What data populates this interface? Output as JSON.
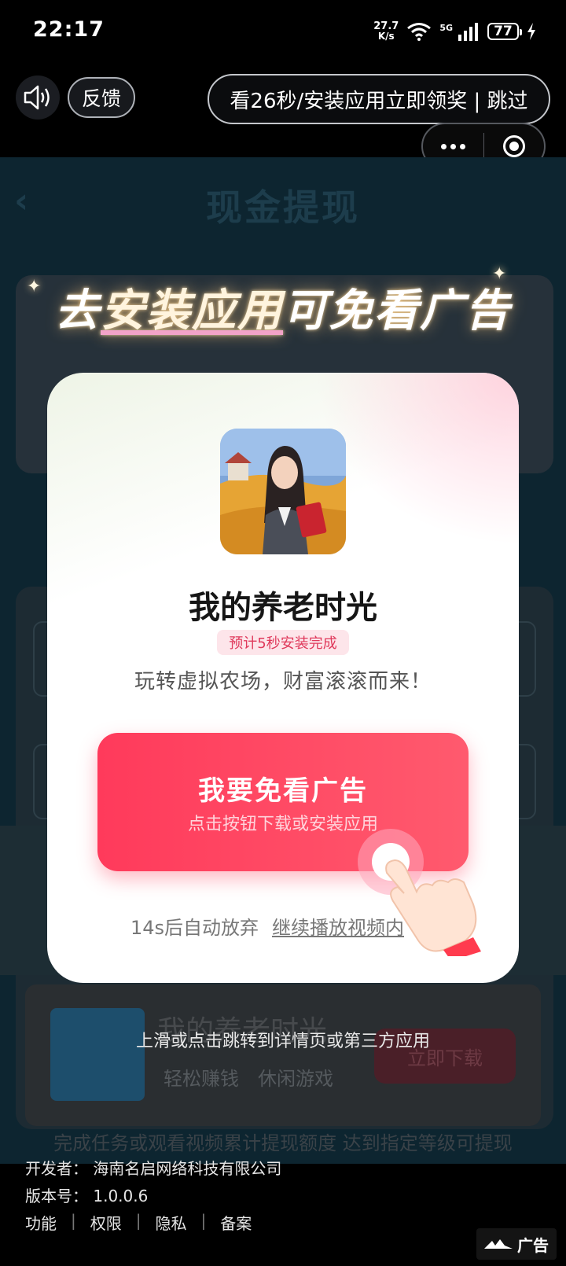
{
  "status_bar": {
    "time": "22:17",
    "net_speed_value": "27.7",
    "net_speed_unit": "K/s",
    "network": "5G",
    "battery": "77",
    "icons": [
      "wifi-icon",
      "signal-icon",
      "battery-icon",
      "charging-icon"
    ]
  },
  "ad_controls": {
    "feedback": "反馈",
    "skip_text": "看26秒/安装应用立即领奖 | 跳过"
  },
  "background_page": {
    "title": "现金提现",
    "back_icon": "‹"
  },
  "promo": {
    "headline_prefix": "去",
    "headline_highlight": "安装应用",
    "headline_suffix": "可免看广告"
  },
  "modal": {
    "app_name": "我的养老时光",
    "install_tag": "预计5秒安装完成",
    "description": "玩转虚拟农场，财富滚滚而来！",
    "cta_title": "我要免看广告",
    "cta_subtitle": "点击按钮下载或安装应用",
    "auto_text": "14s后自动放弃",
    "continue_link": "继续播放视频内"
  },
  "banner": {
    "title": "我的养老时光",
    "tags": [
      "轻松赚钱",
      "休闲游戏"
    ],
    "download_button": "立即下载",
    "swipe_hint": "上滑或点击跳转到详情页或第三方应用"
  },
  "faded_text": "完成任务或观看视频累计提现额度 达到指定等级可提现",
  "footer": {
    "developer": "开发者：  海南名启网络科技有限公司",
    "version": "版本号：  1.0.0.6",
    "links": [
      "功能",
      "权限",
      "隐私",
      "备案"
    ],
    "ad_label": "广告"
  },
  "colors": {
    "cta": "#ff3a5b",
    "tag_bg": "#fde5ea",
    "tag_text": "#e03a5c"
  }
}
